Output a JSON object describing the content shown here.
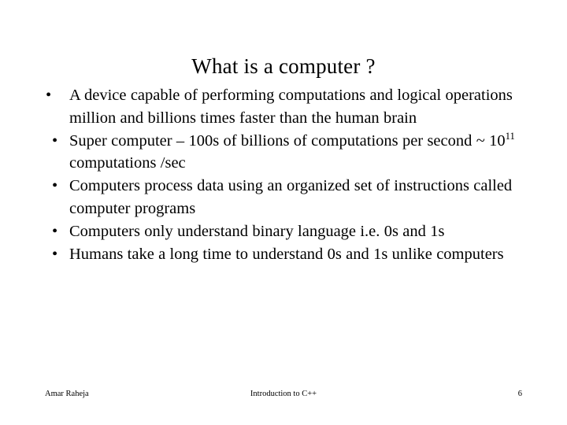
{
  "slide": {
    "title": "What is a computer ?",
    "bullet_marker": "•",
    "bullets": [
      {
        "level": "a",
        "text_before": "A device capable of performing computations and logical operations million and billions times faster than the human brain",
        "superscript": "",
        "text_after": ""
      },
      {
        "level": "b",
        "text_before": "Super computer – 100s of billions of computations per second ~ 10",
        "superscript": "11",
        "text_after": " computations /sec"
      },
      {
        "level": "b",
        "text_before": "Computers process data using an organized set of instructions called computer programs",
        "superscript": "",
        "text_after": ""
      },
      {
        "level": "b",
        "text_before": "Computers only understand binary language i.e. 0s and 1s",
        "superscript": "",
        "text_after": ""
      },
      {
        "level": "b",
        "text_before": "Humans take a long time to understand 0s and 1s unlike computers",
        "superscript": "",
        "text_after": ""
      }
    ],
    "footer": {
      "author": "Amar Raheja",
      "course": "Introduction to C++",
      "page_number": "6"
    },
    "colors": {
      "background": "#ffffff",
      "text": "#000000"
    }
  }
}
